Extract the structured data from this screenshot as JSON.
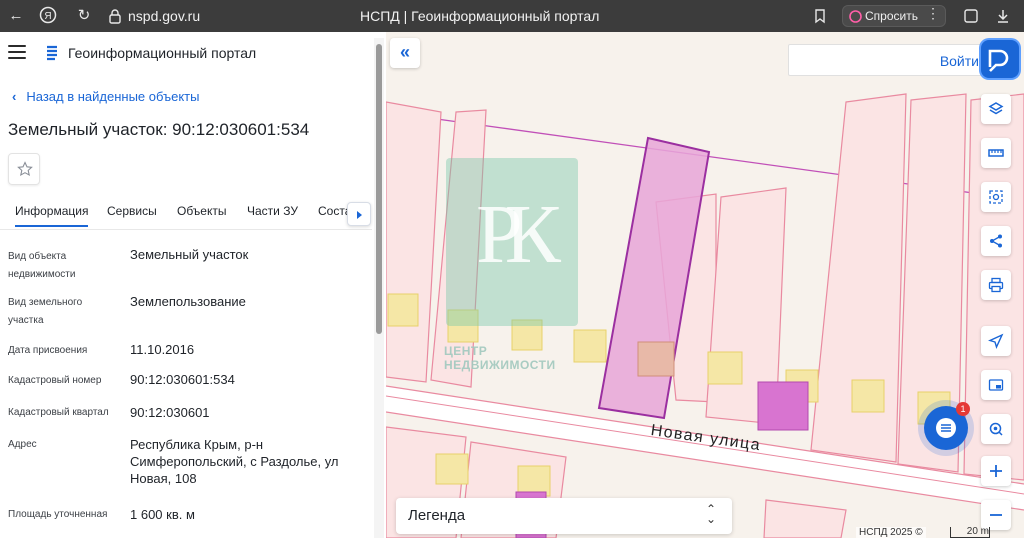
{
  "browser": {
    "url": "nspd.gov.ru",
    "tab_title": "НСПД | Геоинформационный портал",
    "ask_label": "Спросить"
  },
  "header": {
    "portal_title": "Геоинформационный портал"
  },
  "panel": {
    "back_label": "Назад в найденные объекты",
    "object_title": "Земельный участок: 90:12:030601:534",
    "tabs": [
      {
        "label": "Информация"
      },
      {
        "label": "Сервисы"
      },
      {
        "label": "Объекты"
      },
      {
        "label": "Части ЗУ"
      },
      {
        "label": "Соста"
      }
    ],
    "info": [
      {
        "label": "Вид объекта недвижимости",
        "value": "Земельный участок"
      },
      {
        "label": "Вид земельного участка",
        "value": "Землепользование"
      },
      {
        "label": "Дата присвоения",
        "value": "11.10.2016"
      },
      {
        "label": "Кадастровый номер",
        "value": "90:12:030601:534"
      },
      {
        "label": "Кадастровый квартал",
        "value": "90:12:030601"
      },
      {
        "label": "Адрес",
        "value": "Республика Крым, р-н Симферопольский, с Раздолье, ул Новая, 108"
      },
      {
        "label": "Площадь уточненная",
        "value": "1 600 кв. м"
      }
    ]
  },
  "map": {
    "login_label": "Войти",
    "street_label": "Новая улица",
    "watermark_letters": "РК",
    "watermark_text_1": "ЦЕНТР",
    "watermark_text_2": "НЕДВИЖИМОСТИ",
    "legend_label": "Легенда",
    "copyright": "НСПД 2025 ©",
    "scale_label": "20 m",
    "chat_badge": "1"
  },
  "colors": {
    "accent": "#1a66d6",
    "parcel_outline": "#e98aa0",
    "selected_fill": "#e8a6d8",
    "selected_stroke": "#9b2fa0"
  }
}
